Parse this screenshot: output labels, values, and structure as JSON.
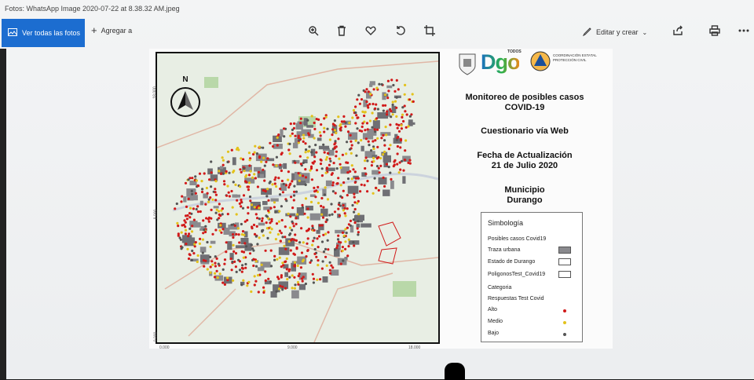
{
  "window": {
    "title": "Fotos: WhatsApp Image 2020-07-22 at 8.38.32 AM.jpeg"
  },
  "toolbar": {
    "see_all": "Ver todas las fotos",
    "add_to": "Agregar a",
    "edit_create": "Editar y crear",
    "icons": [
      "zoom-icon",
      "delete-icon",
      "favorite-icon",
      "rotate-icon",
      "crop-icon",
      "share-icon",
      "print-icon",
      "more-icon"
    ]
  },
  "map": {
    "north": "N",
    "y_ticks": [
      "18.000",
      "9.000",
      "0.000"
    ],
    "x_ticks": [
      "0.000",
      "9.000",
      "18.000"
    ]
  },
  "panel": {
    "logo_text": "Dgo",
    "logo_sub": "TODOS",
    "agency": "COORDINACIÓN ESTATAL PROTECCIÓN CIVIL",
    "title_line1": "Monitoreo de posibles casos",
    "title_line2": "COVID-19",
    "survey": "Cuestionario vía Web",
    "update_line1": "Fecha de Actualización",
    "update_line2": "21 de Julio 2020",
    "muni_line1": "Municipio",
    "muni_line2": "Durango"
  },
  "legend": {
    "title": "Simbología",
    "items": [
      {
        "label": "Posibles casos Covid19"
      },
      {
        "label": "Traza urbana",
        "swatch": "#8a8a8e"
      },
      {
        "label": "Estado de Durango",
        "swatch": "#ffffff"
      },
      {
        "label": "PoligonosTest_Covid19",
        "swatch": "#ffffff"
      },
      {
        "label": "Categoria"
      },
      {
        "label": "Respuestas Test Covid"
      },
      {
        "label": "Alto",
        "dot": "#d11a1a"
      },
      {
        "label": "Medio",
        "dot": "#e3c21b"
      },
      {
        "label": "Bajo",
        "dot": "#555555"
      }
    ]
  },
  "colors": {
    "accent": "#1c6dd0",
    "alto": "#d11a1a",
    "medio": "#e3c21b",
    "bajo": "#555555",
    "urban": "#8a8a8e"
  }
}
